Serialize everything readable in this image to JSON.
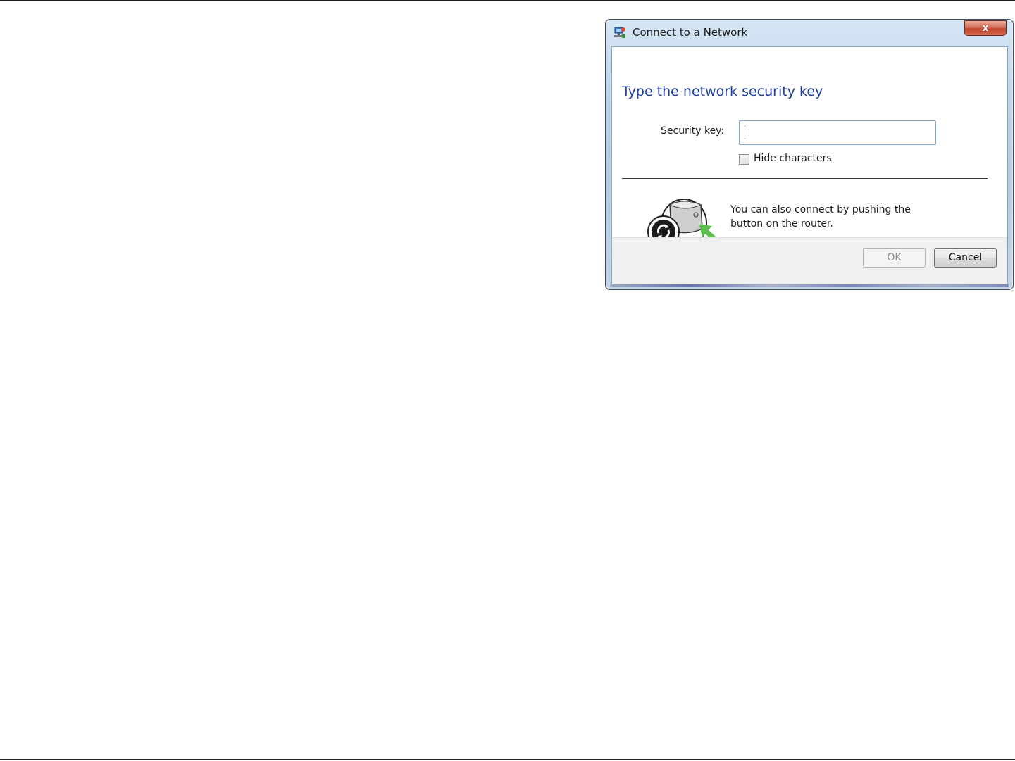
{
  "window": {
    "title": "Connect to a Network",
    "close_label": "x"
  },
  "content": {
    "heading": "Type the network security key",
    "security_key_label": "Security key:",
    "security_key_value": "",
    "hide_characters_label": "Hide characters",
    "hide_characters_checked": false,
    "wps_message": "You can also connect by pushing the button on the router."
  },
  "buttons": {
    "ok_label": "OK",
    "ok_enabled": false,
    "cancel_label": "Cancel"
  },
  "icons": {
    "title": "network-icon",
    "close": "close-icon",
    "wps": "wps-router-button-icon"
  },
  "colors": {
    "heading": "#1e3d9c",
    "close_button": "#c2452c",
    "wps_arrow": "#5cbf4b"
  }
}
